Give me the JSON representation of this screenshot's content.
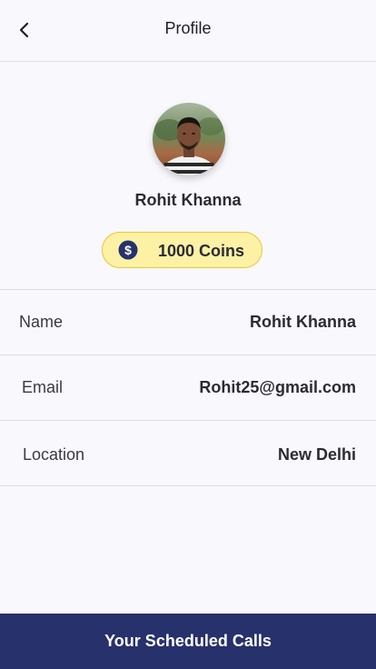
{
  "header": {
    "title": "Profile",
    "back_icon": "chevron-left-icon"
  },
  "profile": {
    "avatar_icon": "user-photo",
    "name": "Rohit Khanna",
    "coins": {
      "icon": "dollar-coin-icon",
      "label": "1000 Coins",
      "badge_color": "#fdf1a6",
      "border_color": "#e8c830"
    }
  },
  "details": [
    {
      "label": "Name",
      "value": "Rohit Khanna"
    },
    {
      "label": "Email",
      "value": "Rohit25@gmail.com"
    },
    {
      "label": "Location",
      "value": "New Delhi"
    }
  ],
  "footer": {
    "button_label": "Your Scheduled Calls",
    "button_color": "#27316b"
  }
}
